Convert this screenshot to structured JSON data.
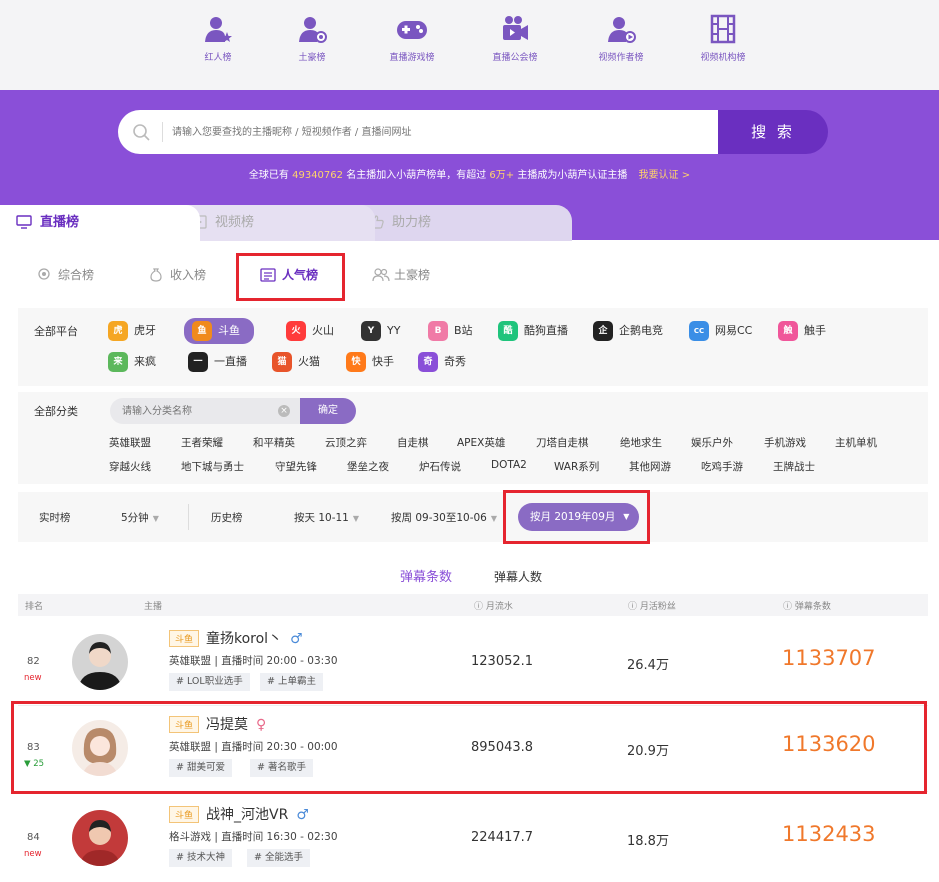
{
  "top_nav": [
    {
      "label": "红人榜"
    },
    {
      "label": "土豪榜"
    },
    {
      "label": "直播游戏榜"
    },
    {
      "label": "直播公会榜"
    },
    {
      "label": "视频作者榜"
    },
    {
      "label": "视频机构榜"
    }
  ],
  "search": {
    "placeholder": "请输入您要查找的主播昵称 / 短视频作者 / 直播间网址",
    "button": "搜 索"
  },
  "notice": {
    "pre": "全球已有",
    "count": "49340762",
    "mid": "名主播加入小葫芦榜单，有超过",
    "amount": "6万+",
    "post": "主播成为小葫芦认证主播",
    "link": "我要认证 >"
  },
  "main_tabs": [
    {
      "label": "直播榜"
    },
    {
      "label": "视频榜"
    },
    {
      "label": "助力榜"
    }
  ],
  "sub_tabs": [
    {
      "label": "综合榜"
    },
    {
      "label": "收入榜"
    },
    {
      "label": "人气榜"
    },
    {
      "label": "土豪榜"
    }
  ],
  "platform": {
    "label": "全部平台",
    "items": [
      {
        "name": "虎牙",
        "color": "#f5a623",
        "glyph": "虎"
      },
      {
        "name": "斗鱼",
        "color": "#f08a1d",
        "glyph": "鱼"
      },
      {
        "name": "火山",
        "color": "#ff3b3b",
        "glyph": "火"
      },
      {
        "name": "YY",
        "color": "#333333",
        "glyph": "Y"
      },
      {
        "name": "B站",
        "color": "#f07aa6",
        "glyph": "B"
      },
      {
        "name": "酷狗直播",
        "color": "#1fc47c",
        "glyph": "酷"
      },
      {
        "name": "企鹅电竞",
        "color": "#222222",
        "glyph": "企"
      },
      {
        "name": "网易CC",
        "color": "#3a8ee6",
        "glyph": "CC"
      },
      {
        "name": "触手",
        "color": "#f0569a",
        "glyph": "触"
      },
      {
        "name": "来疯",
        "color": "#5cb85c",
        "glyph": "来"
      },
      {
        "name": "一直播",
        "color": "#222222",
        "glyph": "一"
      },
      {
        "name": "火猫",
        "color": "#e8542a",
        "glyph": "猫"
      },
      {
        "name": "快手",
        "color": "#ff7a1a",
        "glyph": "快"
      },
      {
        "name": "奇秀",
        "color": "#8a4fd8",
        "glyph": "奇"
      }
    ]
  },
  "category": {
    "label": "全部分类",
    "placeholder": "请输入分类名称",
    "confirm": "确定",
    "items": [
      "英雄联盟",
      "王者荣耀",
      "和平精英",
      "云顶之弈",
      "自走棋",
      "APEX英雄",
      "刀塔自走棋",
      "绝地求生",
      "娱乐户外",
      "手机游戏",
      "主机单机",
      "穿越火线",
      "地下城与勇士",
      "守望先锋",
      "堡垒之夜",
      "炉石传说",
      "DOTA2",
      "WAR系列",
      "其他网游",
      "吃鸡手游",
      "王牌战士"
    ]
  },
  "range": {
    "realtime": "实时榜",
    "interval": "5分钟",
    "history": "历史榜",
    "day": "按天 10-11",
    "week": "按周 09-30至10-06",
    "month": "按月 2019年09月"
  },
  "metric_tabs": [
    {
      "label": "弹幕条数"
    },
    {
      "label": "弹幕人数"
    }
  ],
  "table": {
    "headers": {
      "rank": "排名",
      "anchor": "主播",
      "flow": "月流水",
      "fans": "月活粉丝",
      "danmu": "弹幕条数"
    },
    "rows": [
      {
        "rank": "82",
        "change": "new",
        "platform": "斗鱼",
        "name": "童扬korol丶",
        "gender": "♂",
        "info": "英雄联盟 | 直播时间 20:00 - 03:30",
        "tags": [
          "# LOL职业选手",
          "# 上单霸主"
        ],
        "flow": "123052.1",
        "fans": "26.4万",
        "danmu": "1133707"
      },
      {
        "rank": "83",
        "change": "▼ 25",
        "platform": "斗鱼",
        "name": "冯提莫",
        "gender": "♀",
        "info": "英雄联盟 | 直播时间 20:30 - 00:00",
        "tags": [
          "# 甜美可爱",
          "# 著名歌手"
        ],
        "flow": "895043.8",
        "fans": "20.9万",
        "danmu": "1133620"
      },
      {
        "rank": "84",
        "change": "new",
        "platform": "斗鱼",
        "name": "战神_河池VR",
        "gender": "♂",
        "info": "格斗游戏 | 直播时间 16:30 - 02:30",
        "tags": [
          "# 技术大神",
          "# 全能选手"
        ],
        "flow": "224417.7",
        "fans": "18.8万",
        "danmu": "1132433"
      }
    ]
  },
  "colors": {
    "accent": "#8a4fd8",
    "highlight": "#e5252f",
    "value": "#f0782b"
  }
}
